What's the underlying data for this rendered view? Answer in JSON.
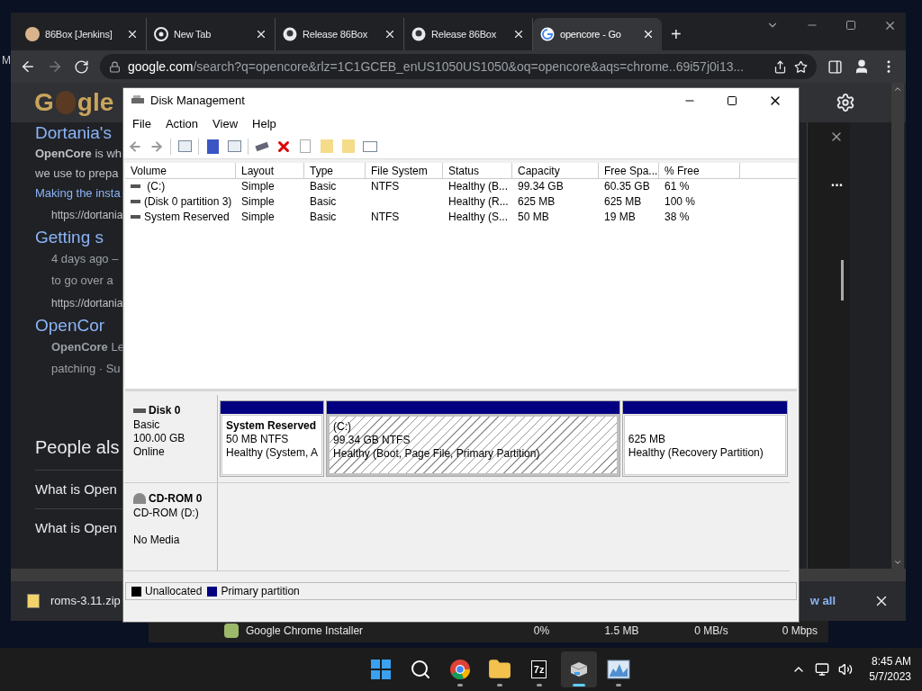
{
  "desktop_fragment": "M",
  "browser": {
    "tabs": [
      {
        "label": "86Box [Jenkins]",
        "kind": "avatar",
        "selected": false
      },
      {
        "label": "New Tab",
        "kind": "chrome",
        "selected": false
      },
      {
        "label": "Release 86Box",
        "kind": "github",
        "selected": false
      },
      {
        "label": "Release 86Box",
        "kind": "github",
        "selected": false
      },
      {
        "label": "opencore - Go",
        "kind": "google",
        "selected": true
      }
    ],
    "new_tab": "+",
    "url_host": "google.com",
    "url_rest": "/search?q=opencore&rlz=1C1GCEB_enUS1050US1050&oq=opencore&aqs=chrome..69i57j0i13...",
    "logo": [
      "G",
      "gle"
    ],
    "results": [
      {
        "kind": "title",
        "text": "Dortania's"
      },
      {
        "kind": "snippet",
        "text": "**OpenCore** is wh"
      },
      {
        "kind": "snippet",
        "text": "we use to prepa"
      },
      {
        "kind": "link",
        "text": "Making the insta"
      },
      {
        "kind": "url",
        "text": "https://dortania"
      },
      {
        "kind": "title",
        "text": "Getting s"
      },
      {
        "kind": "meta",
        "text": "4 days ago –"
      },
      {
        "kind": "meta",
        "text": "to go over a"
      },
      {
        "kind": "url",
        "text": "https://dortania"
      },
      {
        "kind": "title",
        "text": "OpenCor"
      },
      {
        "kind": "meta",
        "text": "**OpenCore** Le"
      },
      {
        "kind": "meta",
        "text": "patching · Su"
      },
      {
        "kind": "heading",
        "text": "People als"
      },
      {
        "kind": "question",
        "text": "What is Open"
      },
      {
        "kind": "question",
        "text": "What is Open"
      }
    ],
    "side_panel": {
      "more": "..."
    },
    "download": {
      "file": "roms-3.11.zip",
      "show_all": "w all"
    }
  },
  "task_manager": {
    "name": "Google Chrome Installer",
    "cells": [
      "0%",
      "1.5 MB",
      "0 MB/s",
      "0 Mbps"
    ]
  },
  "disk_management": {
    "title": "Disk Management",
    "menu": [
      "File",
      "Action",
      "View",
      "Help"
    ],
    "columns": [
      "Volume",
      "Layout",
      "Type",
      "File System",
      "Status",
      "Capacity",
      "Free Spa...",
      "% Free"
    ],
    "rows": [
      [
        " (C:)",
        "Simple",
        "Basic",
        "NTFS",
        "Healthy (B...",
        "99.34 GB",
        "60.35 GB",
        "61 %"
      ],
      [
        "(Disk 0 partition 3)",
        "Simple",
        "Basic",
        "",
        "Healthy (R...",
        "625 MB",
        "625 MB",
        "100 %"
      ],
      [
        "System Reserved",
        "Simple",
        "Basic",
        "NTFS",
        "Healthy (S...",
        "50 MB",
        "19 MB",
        "38 %"
      ]
    ],
    "disks": [
      {
        "kind": "disk",
        "name": "Disk 0",
        "lines": [
          "Basic",
          "100.00 GB",
          "Online"
        ],
        "partitions": [
          {
            "name": "System Reserved",
            "size": "50 MB NTFS",
            "status": "Healthy (System, A",
            "selected": false
          },
          {
            "name": "(C:)",
            "size": "99.34 GB NTFS",
            "status": "Healthy (Boot, Page File, Primary Partition)",
            "selected": true
          },
          {
            "size": "625 MB",
            "status": "Healthy (Recovery Partition)",
            "selected": false
          }
        ]
      },
      {
        "kind": "cdrom",
        "name": "CD-ROM 0",
        "lines": [
          "CD-ROM (D:)",
          "No Media"
        ]
      }
    ],
    "legend": [
      {
        "label": "Unallocated",
        "color": "#000000"
      },
      {
        "label": "Primary partition",
        "color": "#000080"
      }
    ]
  },
  "taskbar": {
    "apps": [
      {
        "kind": "start",
        "selected": false
      },
      {
        "kind": "search",
        "selected": false
      },
      {
        "kind": "chrome",
        "selected": false
      },
      {
        "kind": "folder",
        "selected": false
      },
      {
        "kind": "archive",
        "label": "7z",
        "selected": false
      },
      {
        "kind": "box",
        "selected": true
      },
      {
        "kind": "monitor",
        "selected": false
      }
    ],
    "time": "8:45 AM",
    "date": "5/7/2023"
  }
}
